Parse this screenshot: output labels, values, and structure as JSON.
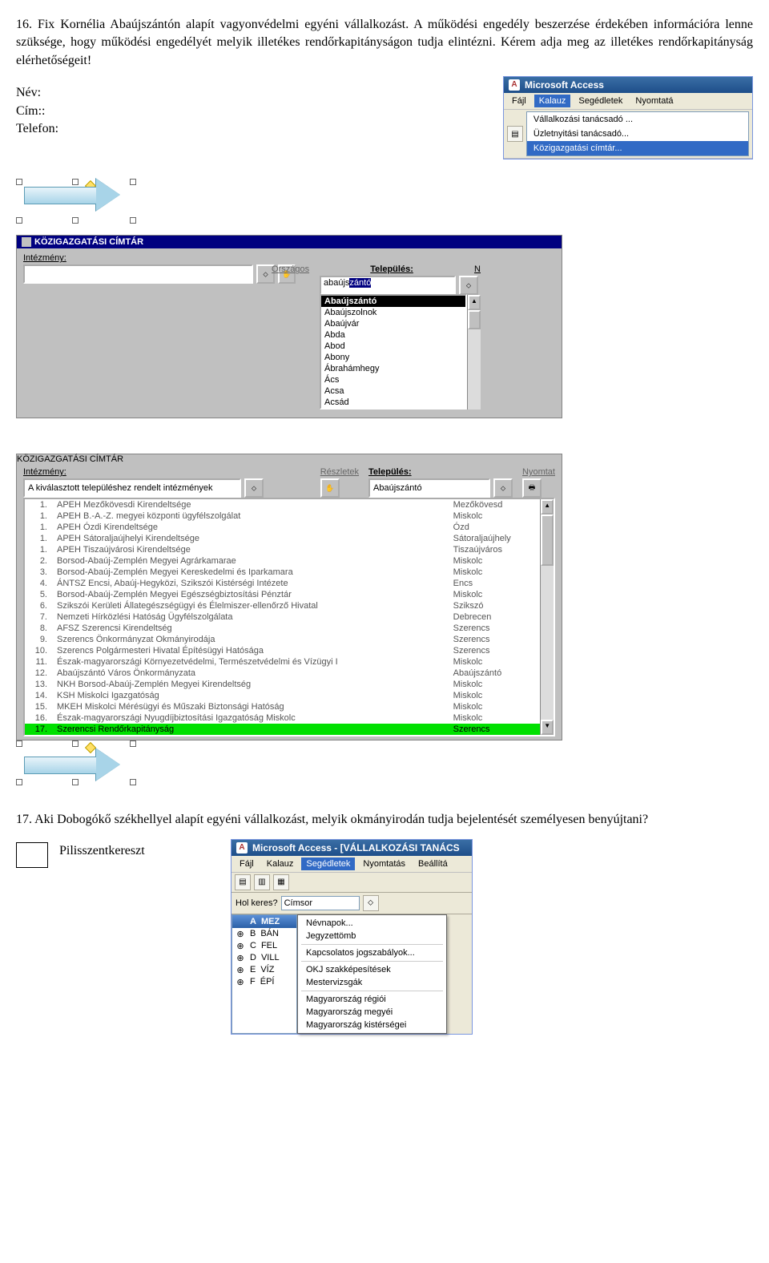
{
  "q16": {
    "text": "16. Fix Kornélia Abaújszántón alapít vagyonvédelmi egyéni vállalkozást. A működési engedély beszerzése érdekében információra lenne szüksége, hogy működési engedélyét melyik illetékes rendőrkapitányságon tudja elintézni. Kérem adja meg  az illetékes rendőrkapitányság elérhetőségeit!",
    "labels": {
      "name": "Név:",
      "address": "Cím::",
      "phone": "Telefon:"
    }
  },
  "access1": {
    "title": "Microsoft Access",
    "menus": [
      "Fájl",
      "Kalauz",
      "Segédletek",
      "Nyomtatá"
    ],
    "dropdown": [
      "Vállalkozási tanácsadó ...",
      "Üzletnyitási tanácsadó...",
      "Közigazgatási címtár..."
    ]
  },
  "dir1": {
    "title": "KÖZIGAZGATÁSI CÍMTÁR",
    "left_label": "Intézmény:",
    "right_label_above": "Országos",
    "right_label": "Település:",
    "right_letter": "N",
    "typed": "abaújs",
    "typed_hl": "zántó",
    "options": [
      "Abaújszántó",
      "Abaújszolnok",
      "Abaújvár",
      "Abda",
      "Abod",
      "Abony",
      "Ábrahámhegy",
      "Ács",
      "Acsa",
      "Acsád"
    ]
  },
  "dir2": {
    "title": "KÖZIGAZGATÁSI CÍMTÁR",
    "left_label": "Intézmény:",
    "left_value": "A kiválasztott településhez rendelt intézmények",
    "mid_label": "Részletek",
    "right_label": "Település:",
    "right_value": "Abaújszántó",
    "print_label": "Nyomtat",
    "rows": [
      {
        "n": "1.",
        "name": "APEH Mezőkövesdi Kirendeltsége",
        "city": "Mezőkövesd"
      },
      {
        "n": "1.",
        "name": "APEH B.-A.-Z. megyei központi ügyfélszolgálat",
        "city": "Miskolc"
      },
      {
        "n": "1.",
        "name": "APEH Ózdi Kirendeltsége",
        "city": "Ózd"
      },
      {
        "n": "1.",
        "name": "APEH Sátoraljaújhelyi Kirendeltsége",
        "city": "Sátoraljaújhely"
      },
      {
        "n": "1.",
        "name": "APEH Tiszaújvárosi Kirendeltsége",
        "city": "Tiszaújváros"
      },
      {
        "n": "2.",
        "name": "Borsod-Abaúj-Zemplén Megyei Agrárkamarae",
        "city": "Miskolc"
      },
      {
        "n": "3.",
        "name": "Borsod-Abaúj-Zemplén Megyei Kereskedelmi és Iparkamara",
        "city": "Miskolc"
      },
      {
        "n": "4.",
        "name": "ÁNTSZ Encsi, Abaúj-Hegyközi, Szikszói Kistérségi Intézete",
        "city": "Encs"
      },
      {
        "n": "5.",
        "name": "Borsod-Abaúj-Zemplén Megyei Egészségbiztosítási Pénztár",
        "city": "Miskolc"
      },
      {
        "n": "6.",
        "name": "Szikszói Kerületi Állategészségügyi és Élelmiszer-ellenőrző Hivatal",
        "city": "Szikszó"
      },
      {
        "n": "7.",
        "name": "Nemzeti Hírközlési Hatóság Ügyfélszolgálata",
        "city": "Debrecen"
      },
      {
        "n": "8.",
        "name": "AFSZ Szerencsi Kirendeltség",
        "city": "Szerencs"
      },
      {
        "n": "9.",
        "name": "Szerencs Önkormányzat Okmányirodája",
        "city": "Szerencs"
      },
      {
        "n": "10.",
        "name": "Szerencs Polgármesteri Hivatal Építésügyi Hatósága",
        "city": "Szerencs"
      },
      {
        "n": "11.",
        "name": "Észak-magyarországi Környezetvédelmi, Természetvédelmi és Vízügyi I",
        "city": "Miskolc"
      },
      {
        "n": "12.",
        "name": "Abaújszántó Város Önkormányzata",
        "city": "Abaújszántó"
      },
      {
        "n": "13.",
        "name": "NKH Borsod-Abaúj-Zemplén Megyei Kirendeltség",
        "city": "Miskolc"
      },
      {
        "n": "14.",
        "name": "KSH Miskolci Igazgatóság",
        "city": "Miskolc"
      },
      {
        "n": "15.",
        "name": "MKEH Miskolci Mérésügyi és Műszaki Biztonsági Hatóság",
        "city": "Miskolc"
      },
      {
        "n": "16.",
        "name": "Észak-magyarországi Nyugdíjbiztosítási Igazgatóság Miskolc",
        "city": "Miskolc"
      },
      {
        "n": "17.",
        "name": "Szerencsi Rendőrkapitányság",
        "city": "Szerencs",
        "hl": true
      }
    ]
  },
  "q17": {
    "text": "17. Aki Dobogókő székhellyel alapít egyéni vállalkozást, melyik okmányirodán tudja bejelentését személyesen benyújtani?",
    "answer": "Pilisszentkereszt"
  },
  "access2": {
    "title": "Microsoft Access - [VÁLLALKOZÁSI TANÁCS",
    "menus": [
      "Fájl",
      "Kalauz",
      "Segédletek",
      "Nyomtatás",
      "Beállítá"
    ],
    "holker_label": "Hol keres?",
    "holker_value": "Címsor",
    "rightmenu_top": [
      "Névnapok...",
      "Jegyzettömb"
    ],
    "rightmenu_mid": [
      "Kapcsolatos jogszabályok..."
    ],
    "rightmenu_bot": [
      "OKJ szakképesítések",
      "Mestervizsgák"
    ],
    "rightmenu_last": [
      "Magyarország régiói",
      "Magyarország megyéi",
      "Magyarország kistérségei"
    ],
    "leftlist_title_a": "A",
    "leftlist_title_b": "MEZ",
    "rows": [
      {
        "s": "⊕",
        "a": "B",
        "b": "BÁN"
      },
      {
        "s": "⊕",
        "a": "C",
        "b": "FEL"
      },
      {
        "s": "⊕",
        "a": "D",
        "b": "VILL"
      },
      {
        "s": "⊕",
        "a": "E",
        "b": "VÍZ"
      },
      {
        "s": "⊕",
        "a": "F",
        "b": "ÉPÍ"
      }
    ]
  }
}
